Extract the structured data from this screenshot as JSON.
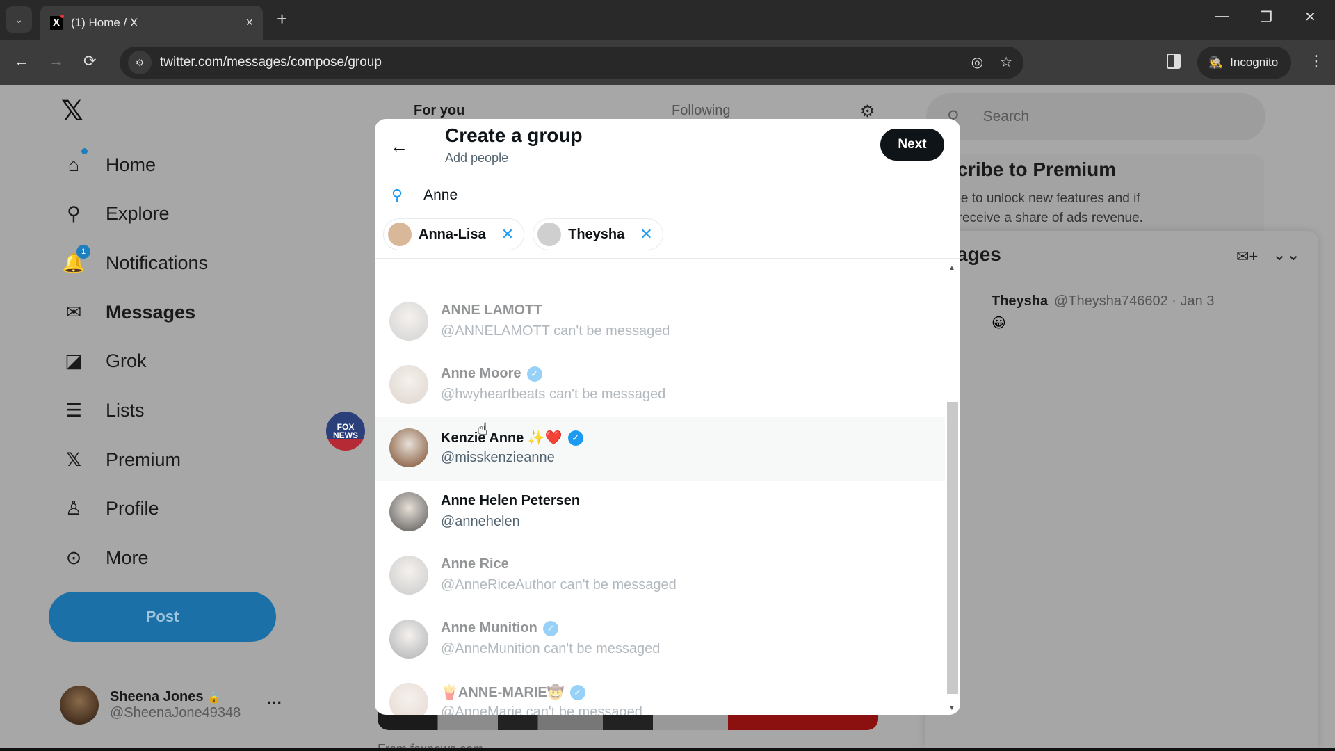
{
  "browser": {
    "tab_title": "(1) Home / X",
    "tab_close": "×",
    "new_tab": "+",
    "url": "twitter.com/messages/compose/group",
    "incognito_label": "Incognito",
    "window_controls": {
      "minimize": "—",
      "restore": "❐",
      "close": "✕"
    }
  },
  "sidebar": {
    "logo": "𝕏",
    "items": [
      {
        "label": "Home",
        "icon": "home-icon",
        "glyph": "⌂"
      },
      {
        "label": "Explore",
        "icon": "search-icon",
        "glyph": "⚲"
      },
      {
        "label": "Notifications",
        "icon": "bell-icon",
        "glyph": "🔔",
        "badge": "1"
      },
      {
        "label": "Messages",
        "icon": "envelope-icon",
        "glyph": "✉",
        "active": true
      },
      {
        "label": "Grok",
        "icon": "grok-icon",
        "glyph": "◪"
      },
      {
        "label": "Lists",
        "icon": "list-icon",
        "glyph": "☰"
      },
      {
        "label": "Premium",
        "icon": "x-icon",
        "glyph": "𝕏"
      },
      {
        "label": "Profile",
        "icon": "person-icon",
        "glyph": "👤"
      },
      {
        "label": "More",
        "icon": "more-circle-icon",
        "glyph": "⋯"
      }
    ],
    "post_label": "Post",
    "account": {
      "name": "Sheena Jones",
      "handle": "@SheenaJone49348",
      "lock": "🔒",
      "more": "···"
    }
  },
  "timeline": {
    "tabs": [
      "For you",
      "Following"
    ],
    "fox_label": "FOX NEWS",
    "source_text": "From foxnews.com"
  },
  "right": {
    "search_placeholder": "Search",
    "premium_title": "Subscribe to Premium",
    "premium_desc": "Subscribe to unlock new features and if eligible, receive a share of ads revenue.",
    "messages_title": "Messages",
    "conversation": {
      "name": "Theysha",
      "meta": "@Theysha746602 · Jan 3",
      "preview": "😀"
    }
  },
  "modal": {
    "title": "Create a group",
    "subtitle": "Add people",
    "next_label": "Next",
    "search_value": "Anne",
    "chips": [
      {
        "label": "Anna-Lisa",
        "avatar_color": "#d9b89a"
      },
      {
        "label": "Theysha",
        "avatar_color": "#cfcfcf"
      }
    ],
    "results": [
      {
        "name": "ANNE LAMOTT",
        "handle": "@ANNELAMOTT can't be messaged",
        "verified": false,
        "disabled": true,
        "avatar_color": "#9a9a9a"
      },
      {
        "name": "Anne Moore",
        "handle": "@hwyheartbeats can't be messaged",
        "verified": true,
        "disabled": true,
        "avatar_color": "#b5a08e"
      },
      {
        "name": "Kenzie Anne ✨❤️",
        "handle": "@misskenzieanne",
        "verified": true,
        "disabled": false,
        "hover": true,
        "avatar_color": "#7a4a2a"
      },
      {
        "name": "Anne Helen Petersen",
        "handle": "@annehelen",
        "verified": false,
        "disabled": false,
        "avatar_color": "#555555"
      },
      {
        "name": "Anne Rice",
        "handle": "@AnneRiceAuthor can't be messaged",
        "verified": false,
        "disabled": true,
        "avatar_color": "#8a8a8a"
      },
      {
        "name": "Anne Munition",
        "handle": "@AnneMunition can't be messaged",
        "verified": true,
        "disabled": true,
        "avatar_color": "#4a5058"
      },
      {
        "name": "🍟ANNE-MARIE🤠",
        "handle": "@AnneMarie can't be messaged",
        "verified": true,
        "disabled": true,
        "avatar_color": "#c8a898"
      }
    ]
  },
  "colors": {
    "accent": "#1d9bf0",
    "text": "#0f1419",
    "muted": "#536471",
    "post_button": "#1b70a7"
  }
}
